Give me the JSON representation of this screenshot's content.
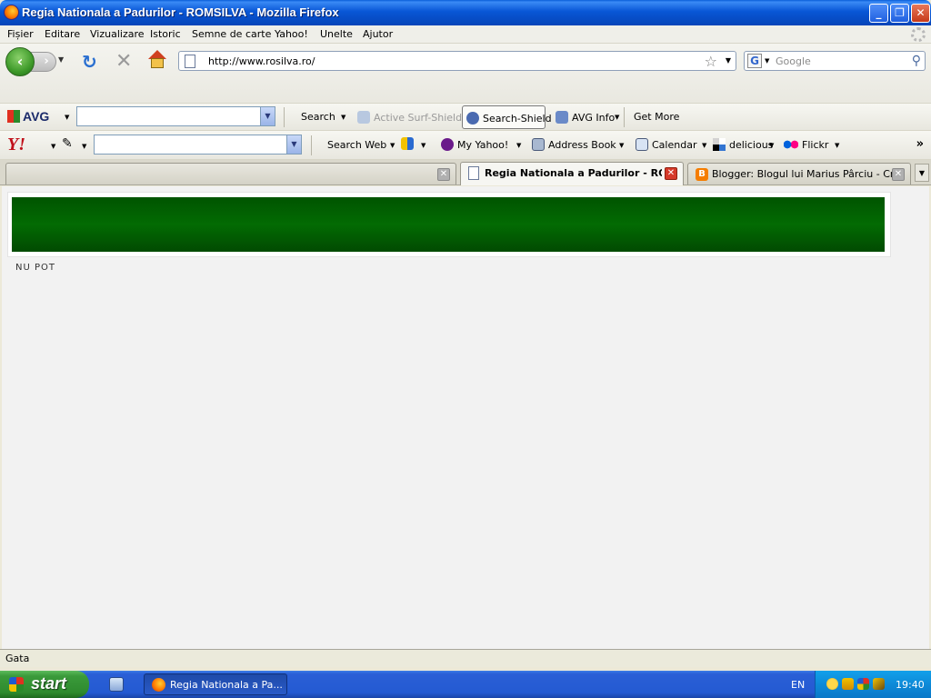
{
  "window": {
    "title": "Regia Nationala a Padurilor - ROMSILVA - Mozilla Firefox",
    "buttons": {
      "minimize": "_",
      "maximize": "❐",
      "close": "✕"
    }
  },
  "menu": {
    "items": [
      "Fișier",
      "Editare",
      "Vizualizare",
      "Istoric",
      "Semne de carte",
      "Yahoo!",
      "Unelte",
      "Ajutor"
    ]
  },
  "nav": {
    "url": "http://www.rosilva.ro/",
    "search_placeholder": "Google",
    "search_engine_icon": "G"
  },
  "avg_toolbar": {
    "logo": "AVG",
    "search_label": "Search",
    "active_surf_shield": "Active Surf-Shield",
    "search_shield": "Search-Shield",
    "avg_info": "AVG Info",
    "get_more": "Get More"
  },
  "yahoo_toolbar": {
    "logo": "Y!",
    "search_web": "Search Web",
    "my_yahoo": "My Yahoo!",
    "address_book": "Address Book",
    "calendar": "Calendar",
    "delicious": "delicious",
    "flickr": "Flickr",
    "overflow": "»"
  },
  "tabs": [
    {
      "label": "",
      "active": false
    },
    {
      "label": "Regia Nationala a Padurilor - RO...",
      "active": true
    },
    {
      "label": "Blogger: Blogul lui Marius Pârciu - Creaţi...",
      "active": false
    }
  ],
  "content": {
    "text": "NU POT"
  },
  "status": {
    "text": "Gata"
  },
  "taskbar": {
    "start": "start",
    "task_label": "Regia Nationala a Pa...",
    "language": "EN",
    "clock": "19:40"
  },
  "colors": {
    "banner_green": "#036b03",
    "titlebar_blue": "#0856d6",
    "taskbar_blue": "#245ad2"
  }
}
